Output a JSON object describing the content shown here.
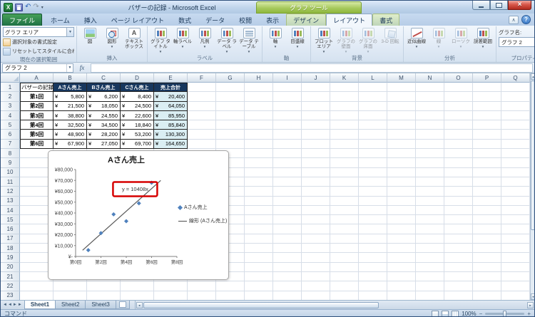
{
  "window": {
    "title": "バザーの記録 - Microsoft Excel",
    "contextual_label": "グラフ ツール"
  },
  "qat": {
    "icons": [
      "excel-logo",
      "save-icon",
      "undo-icon",
      "redo-icon",
      "qat-dropdown-icon"
    ]
  },
  "ribbon": {
    "tabs": [
      {
        "label": "ファイル",
        "name": "file",
        "style": "file"
      },
      {
        "label": "ホーム",
        "name": "home",
        "style": ""
      },
      {
        "label": "挿入",
        "name": "insert",
        "style": ""
      },
      {
        "label": "ページ レイアウト",
        "name": "page-layout",
        "style": ""
      },
      {
        "label": "数式",
        "name": "formulas",
        "style": ""
      },
      {
        "label": "データ",
        "name": "data",
        "style": ""
      },
      {
        "label": "校閲",
        "name": "review",
        "style": ""
      },
      {
        "label": "表示",
        "name": "view",
        "style": ""
      },
      {
        "label": "デザイン",
        "name": "chart-design",
        "style": "contextual"
      },
      {
        "label": "レイアウト",
        "name": "chart-layout",
        "style": "contextual active"
      },
      {
        "label": "書式",
        "name": "chart-format",
        "style": "contextual"
      }
    ],
    "groups": [
      {
        "label": "現在の選択範囲",
        "name": "current-selection",
        "layout": "stack",
        "items": [
          {
            "type": "combo",
            "name": "chart-elements-combo",
            "label": "グラフ エリア"
          },
          {
            "type": "small",
            "name": "format-selection-button",
            "icon": "format-selection-icon",
            "label": "選択対象の書式設定"
          },
          {
            "type": "small",
            "name": "reset-to-match-style-button",
            "icon": "reset-style-icon",
            "label": "リセットしてスタイルに合わせる"
          }
        ]
      },
      {
        "label": "挿入",
        "name": "insert-group",
        "items": [
          {
            "type": "large",
            "name": "picture-button",
            "icon": "picture-icon",
            "label": "図"
          },
          {
            "type": "large",
            "name": "shapes-button",
            "icon": "shapes-icon",
            "label": "図形",
            "dd": true
          },
          {
            "type": "large",
            "name": "textbox-button",
            "icon": "textbox-icon",
            "label": "テキスト ボックス"
          }
        ]
      },
      {
        "label": "ラベル",
        "name": "labels-group",
        "items": [
          {
            "type": "large",
            "name": "chart-title-button",
            "icon": "chart-title-icon",
            "label": "グラフ タイトル",
            "dd": true
          },
          {
            "type": "large",
            "name": "axis-labels-button",
            "icon": "axis-titles-icon",
            "label": "軸ラベル",
            "dd": true
          },
          {
            "type": "large",
            "name": "legend-button",
            "icon": "legend-icon",
            "label": "凡例",
            "dd": true
          },
          {
            "type": "large",
            "name": "data-labels-button",
            "icon": "data-labels-icon",
            "label": "データ ラベル",
            "dd": true
          },
          {
            "type": "large",
            "name": "data-table-button",
            "icon": "data-table-icon",
            "label": "データ テーブル",
            "dd": true
          }
        ]
      },
      {
        "label": "軸",
        "name": "axes-group",
        "items": [
          {
            "type": "large",
            "name": "axes-button",
            "icon": "axes-icon",
            "label": "軸",
            "dd": true
          },
          {
            "type": "large",
            "name": "gridlines-button",
            "icon": "gridlines-icon",
            "label": "目盛線",
            "dd": true
          }
        ]
      },
      {
        "label": "背景",
        "name": "background-group",
        "items": [
          {
            "type": "large",
            "name": "plot-area-button",
            "icon": "plot-area-icon",
            "label": "プロット エリア",
            "dd": true
          },
          {
            "type": "large",
            "name": "chart-wall-button",
            "icon": "chart-wall-icon",
            "label": "グラフの壁面",
            "dd": true,
            "disabled": true
          },
          {
            "type": "large",
            "name": "chart-floor-button",
            "icon": "chart-floor-icon",
            "label": "グラフの床面",
            "dd": true,
            "disabled": true
          },
          {
            "type": "large",
            "name": "rotation-button",
            "icon": "rotation-icon",
            "label": "3-D 回転",
            "disabled": true
          }
        ]
      },
      {
        "label": "分析",
        "name": "analysis-group",
        "items": [
          {
            "type": "large",
            "name": "trendline-button",
            "icon": "trendline-icon",
            "label": "近似曲線",
            "dd": true
          },
          {
            "type": "large",
            "name": "lines-button",
            "icon": "lines-icon",
            "label": "線",
            "dd": true,
            "disabled": true
          },
          {
            "type": "large",
            "name": "updown-bars-button",
            "icon": "updown-bars-icon",
            "label": "ローソク",
            "dd": true,
            "disabled": true
          },
          {
            "type": "large",
            "name": "error-bars-button",
            "icon": "error-bars-icon",
            "label": "誤差範囲",
            "dd": true
          }
        ]
      },
      {
        "label": "プロパティ",
        "name": "properties-group",
        "items": [
          {
            "type": "field",
            "name": "chart-name-field",
            "label": "グラフ名:",
            "value": "グラフ 2"
          }
        ]
      }
    ]
  },
  "formula_bar": {
    "name_box": "グラフ 2",
    "fx_label": "fx",
    "formula": ""
  },
  "sheet": {
    "columns": [
      "A",
      "B",
      "C",
      "D",
      "E",
      "F",
      "G",
      "H",
      "I",
      "J",
      "K",
      "L",
      "M",
      "N",
      "O",
      "P",
      "Q"
    ],
    "visible_rows": 23,
    "table": {
      "title": "バザーの記録",
      "currency": "¥",
      "header_labels": [
        "Aさん売上",
        "Bさん売上",
        "Cさん売上",
        "売上合計"
      ],
      "rows": [
        {
          "row": 2,
          "label": "第1回",
          "values": [
            "5,800",
            "6,200",
            "8,400"
          ],
          "total": "20,400"
        },
        {
          "row": 3,
          "label": "第2回",
          "values": [
            "21,500",
            "18,050",
            "24,500"
          ],
          "total": "64,050"
        },
        {
          "row": 4,
          "label": "第3回",
          "values": [
            "38,800",
            "24,550",
            "22,600"
          ],
          "total": "85,950"
        },
        {
          "row": 5,
          "label": "第4回",
          "values": [
            "32,500",
            "34,500",
            "18,840"
          ],
          "total": "85,840"
        },
        {
          "row": 6,
          "label": "第5回",
          "values": [
            "48,900",
            "28,200",
            "53,200"
          ],
          "total": "130,300"
        },
        {
          "row": 7,
          "label": "第6回",
          "values": [
            "67,900",
            "27,050",
            "69,700"
          ],
          "total": "164,650"
        }
      ]
    }
  },
  "chart_data": {
    "type": "scatter",
    "title": "Aさん売上",
    "series": [
      {
        "name": "Aさん売上",
        "marker": "diamond",
        "color": "#4f81bd",
        "points": [
          [
            1,
            5800
          ],
          [
            2,
            21500
          ],
          [
            3,
            38800
          ],
          [
            4,
            32500
          ],
          [
            5,
            48900
          ],
          [
            6,
            67900
          ]
        ]
      }
    ],
    "trendline": {
      "name": "線形 (Aさん売上)",
      "equation": "y = 10408x",
      "slope": 10408,
      "color": "#595959",
      "x_range": [
        0.55,
        6.72
      ],
      "label_x": 4.7,
      "label_y": 62000
    },
    "xlim": [
      0,
      8
    ],
    "ylim": [
      0,
      80000
    ],
    "x_ticks": [
      "第0回",
      "第2回",
      "第4回",
      "第6回",
      "第8回"
    ],
    "y_ticks": [
      "¥80,000",
      "¥70,000",
      "¥60,000",
      "¥50,000",
      "¥40,000",
      "¥30,000",
      "¥20,000",
      "¥10,000",
      "¥-"
    ],
    "legend_position": "right",
    "grid": false,
    "annotation": {
      "shape": "red-rounded-rect",
      "target": "trendline-equation",
      "color": "#d60000"
    }
  },
  "sheet_tabs": {
    "tabs": [
      "Sheet1",
      "Sheet2",
      "Sheet3"
    ],
    "active_index": 0
  },
  "status": {
    "mode": "コマンド",
    "zoom": "100%"
  }
}
